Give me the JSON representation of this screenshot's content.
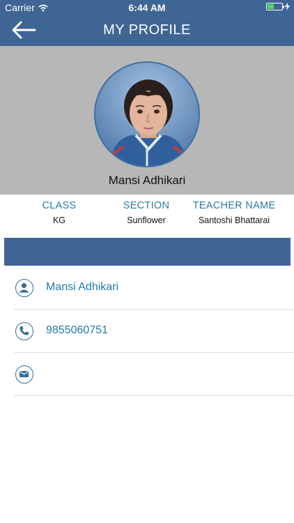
{
  "status_bar": {
    "carrier": "Carrier",
    "time": "6:44 AM",
    "battery_level": 0.45
  },
  "nav": {
    "title": "MY PROFILE",
    "back_icon": "back-arrow-icon"
  },
  "profile": {
    "name": "Mansi Adhikari"
  },
  "info": {
    "class_label": "CLASS",
    "class_value": "KG",
    "section_label": "SECTION",
    "section_value": "Sunflower",
    "teacher_label": "TEACHER NAME",
    "teacher_value": "Santoshi Bhattarai"
  },
  "details": {
    "name": "Mansi Adhikari",
    "phone": "9855060751",
    "email": ""
  },
  "colors": {
    "header": "#3f6594",
    "accent": "#1f7aa8",
    "hero_bg": "#b7b7b7"
  }
}
